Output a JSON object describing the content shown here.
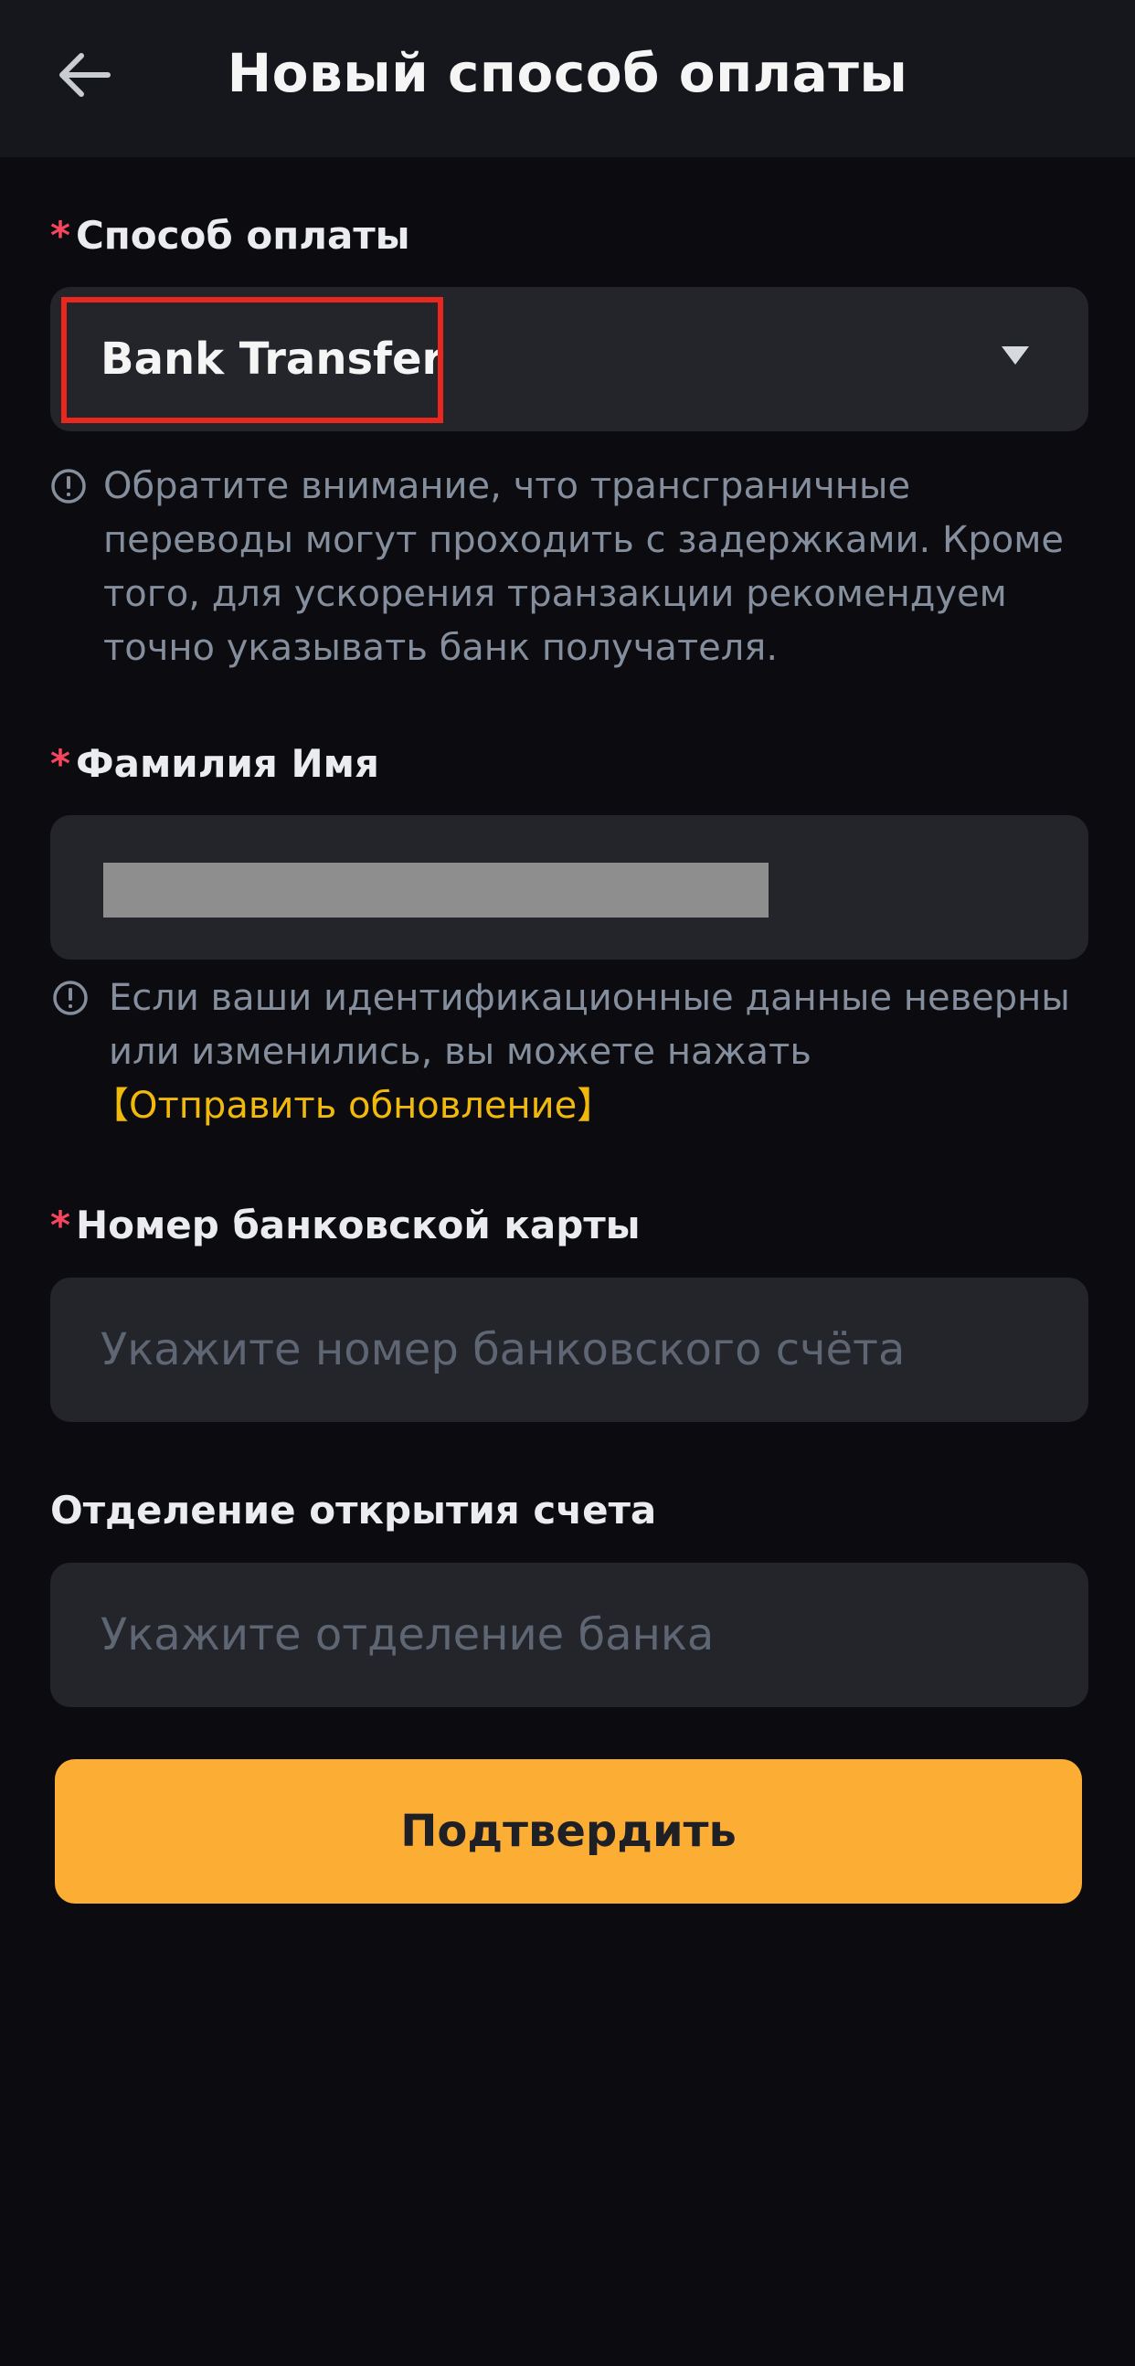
{
  "header": {
    "title": "Новый способ оплаты",
    "back_icon": "arrow-left-icon"
  },
  "form": {
    "payment_method": {
      "label": "Способ оплаты",
      "required_mark": "*",
      "value": "Bank Transfer",
      "caret_icon": "caret-down-icon",
      "note": "Обратите внимание, что трансграничные переводы могут проходить с задержками. Кроме того, для ускорения транзакции рекомендуем точно указывать банк получателя."
    },
    "full_name": {
      "label": "Фамилия Имя",
      "required_mark": "*",
      "value_redacted": true,
      "note": "Если ваши идентификационные данные неверны или изменились, вы можете нажать",
      "note_link": "【Отправить обновление】"
    },
    "card_number": {
      "label": "Номер банковской карты",
      "required_mark": "*",
      "placeholder": "Укажите номер банковского счёта"
    },
    "branch": {
      "label": "Отделение открытия счета",
      "placeholder": "Укажите отделение банка"
    }
  },
  "actions": {
    "confirm_label": "Подтвердить"
  },
  "colors": {
    "background": "#0b0b10",
    "header_bg": "#16171c",
    "input_bg": "#23252b",
    "accent": "#fcad33",
    "link": "#f0b90b",
    "required": "#f6465d",
    "highlight": "#e8281e"
  }
}
